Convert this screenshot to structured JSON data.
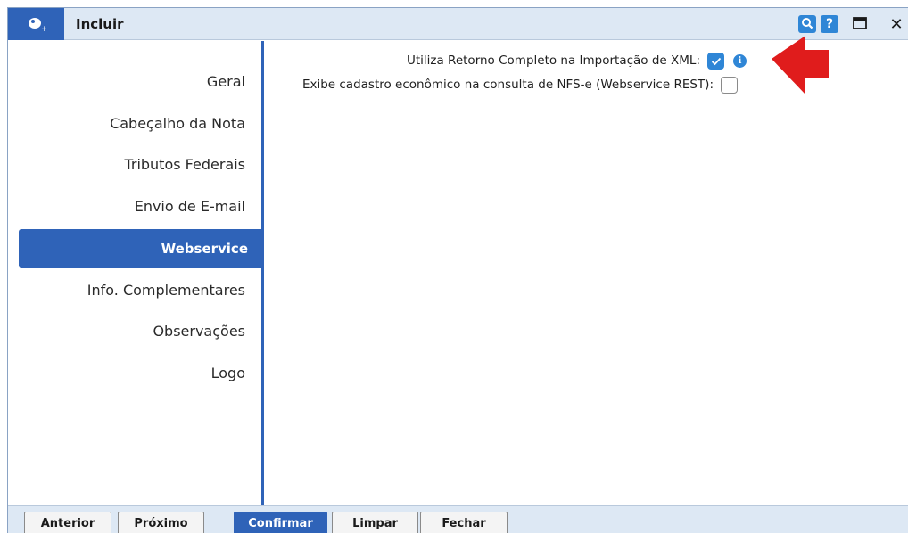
{
  "window": {
    "title": "Incluir",
    "help_label": "?",
    "close_label": "✕"
  },
  "sidebar": {
    "items": [
      {
        "label": "Geral",
        "active": false
      },
      {
        "label": "Cabeçalho da Nota",
        "active": false
      },
      {
        "label": "Tributos Federais",
        "active": false
      },
      {
        "label": "Envio de E-mail",
        "active": false
      },
      {
        "label": "Webservice",
        "active": true
      },
      {
        "label": "Info. Complementares",
        "active": false
      },
      {
        "label": "Observações",
        "active": false
      },
      {
        "label": "Logo",
        "active": false
      }
    ]
  },
  "content": {
    "fields": [
      {
        "label": "Utiliza Retorno Completo na Importação de XML:",
        "checked": true,
        "has_info": true
      },
      {
        "label": "Exibe cadastro econômico na consulta de NFS-e (Webservice REST):",
        "checked": false,
        "has_info": false
      }
    ]
  },
  "buttons": {
    "anterior": "Anterior",
    "proximo": "Próximo",
    "confirmar": "Confirmar",
    "limpar": "Limpar",
    "fechar": "Fechar"
  },
  "colors": {
    "accent": "#2f63b8",
    "checkbox_blue": "#2f86d6",
    "arrow_red": "#e01c1c",
    "bar_bg": "#dde8f4"
  },
  "icons": {
    "app": "app-logo-icon",
    "search": "search-icon",
    "help": "help-icon",
    "maximize": "maximize-icon",
    "close": "close-icon",
    "info": "info-icon",
    "annotation": "red-arrow-icon"
  }
}
